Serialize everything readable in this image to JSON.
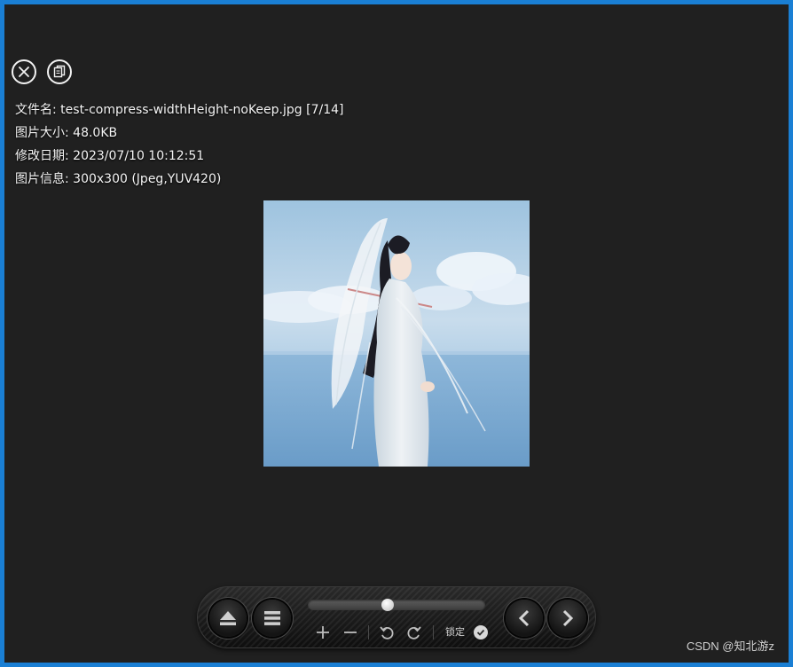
{
  "file_info": {
    "filename": "文件名: test-compress-widthHeight-noKeep.jpg [7/14]",
    "size": "图片大小: 48.0KB",
    "modified": "修改日期: 2023/07/10 10:12:51",
    "image_info": "图片信息: 300x300 (Jpeg,YUV420)"
  },
  "top_controls": [
    {
      "icon": "close-icon"
    },
    {
      "icon": "copy-icon"
    }
  ],
  "toolbar": {
    "slider_value": 0.45,
    "lock_label": "锁定",
    "lock_checked": true,
    "buttons": [
      "eject-icon",
      "menu-icon",
      "zoom-in-icon",
      "zoom-out-icon",
      "rotate-left-icon",
      "rotate-right-icon",
      "prev-icon",
      "next-icon"
    ]
  },
  "watermark": "CSDN @知北游z",
  "colors": {
    "border": "#1a7fd4",
    "background": "#202020",
    "text": "#f4f4f4"
  }
}
